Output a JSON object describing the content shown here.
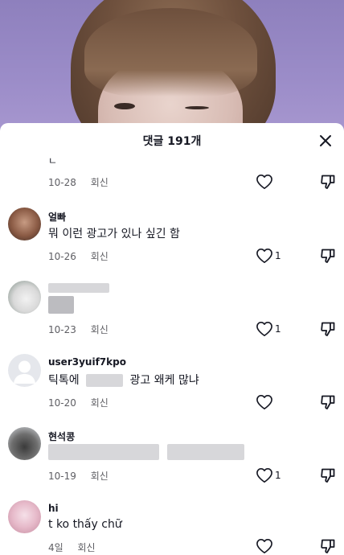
{
  "sheet": {
    "title": "댓글 191개"
  },
  "partial_comment": {
    "text": "ㄴ",
    "date": "10-28",
    "reply_label": "회신",
    "like_count": ""
  },
  "comments": [
    {
      "username": "얼빠",
      "text": "뭐 이런 광고가 있나 싶긴 함",
      "date": "10-26",
      "reply_label": "회신",
      "like_count": "1"
    },
    {
      "username": "",
      "text": "",
      "date": "10-23",
      "reply_label": "회신",
      "like_count": "1"
    },
    {
      "username": "user3yuif7kpo",
      "text_before": "틱톡에",
      "text_after": "광고 왜케 많냐",
      "date": "10-20",
      "reply_label": "회신",
      "like_count": ""
    },
    {
      "username": "현석콩",
      "text": "",
      "date": "10-19",
      "reply_label": "회신",
      "like_count": "1"
    },
    {
      "username": "hi",
      "text": "t ko thấy chữ",
      "date": "4일",
      "reply_label": "회신",
      "like_count": ""
    }
  ],
  "icons": {
    "close": "close-icon",
    "like": "heart-icon",
    "dislike": "thumbs-down-icon"
  },
  "colors": {
    "text": "#161823",
    "meta": "#5e5e63",
    "icon": "#161823"
  }
}
